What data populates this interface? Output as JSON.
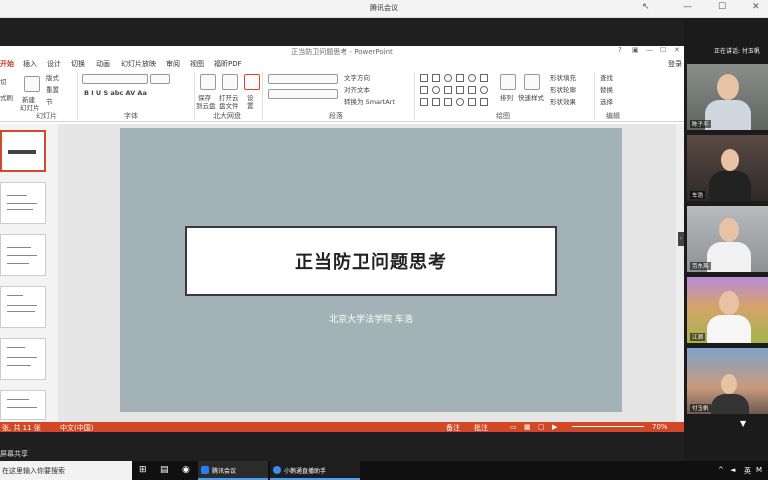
{
  "meeting": {
    "window_title": "腾讯会议",
    "speaking_label": "正在讲话: 付玉帆",
    "share_label": "屏幕共享"
  },
  "ppt": {
    "window_title": "正当防卫问题思考 - PowerPoint",
    "help": "?",
    "tabs": [
      "开始",
      "插入",
      "设计",
      "切换",
      "动画",
      "幻灯片放映",
      "审阅",
      "视图",
      "福昕PDF"
    ],
    "login": "登录",
    "ribbon": {
      "layout": "版式",
      "reset": "重置",
      "section": "节",
      "new_slide": "新建",
      "new_slide2": "幻灯片",
      "new_slide_arrow": "▾",
      "left_edge_a": "切",
      "left_edge_b": "式刷",
      "save_cloud_a": "保存",
      "save_cloud_b": "到云盘",
      "open_cloud_a": "打开云",
      "open_cloud_b": "盘文件",
      "settings_a": "设",
      "settings_b": "置",
      "text_dir": "文字方向",
      "align_text": "对齐文本",
      "to_smartart": "转换为 SmartArt",
      "arrange": "排列",
      "quick_styles": "快速样式",
      "shape_fill": "形状填充",
      "shape_outline": "形状轮廓",
      "shape_effect": "形状效果",
      "find": "查找",
      "replace": "替换",
      "select": "选择",
      "font_buttons": "B I U S abc AV Aa"
    },
    "groups": {
      "slides": "幻灯片",
      "font": "字体",
      "cloud": "北大网盘",
      "paragraph": "段落",
      "drawing": "绘图",
      "edit": "编辑"
    },
    "slide": {
      "title": "正当防卫问题思考",
      "subtitle": "北京大学法学院 车浩"
    },
    "status": {
      "slide_count": "张, 共 11 张",
      "language": "中文(中国)",
      "notes": "备注",
      "comments": "批注",
      "zoom": "70%"
    }
  },
  "participants": [
    {
      "name": "陈子平"
    },
    {
      "name": "车浩"
    },
    {
      "name": "劳东燕"
    },
    {
      "name": "江溯"
    },
    {
      "name": "付玉帆"
    }
  ],
  "taskbar": {
    "search_placeholder": "在这里输入你要搜索",
    "apps": [
      "腾讯会议",
      "小鹅通直播助手"
    ],
    "tray_lang": "英",
    "tray_ime": "M"
  },
  "colors": {
    "ppt_accent": "#d24726",
    "slide_bg": "#a3b2b7"
  }
}
